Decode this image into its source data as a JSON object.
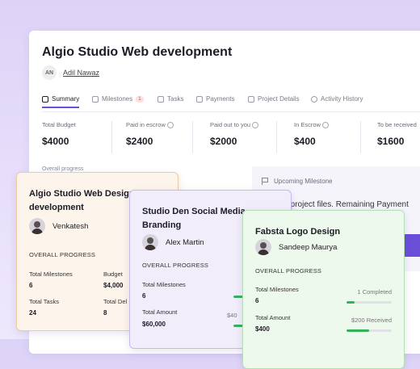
{
  "project": {
    "title": "Algio Studio Web development",
    "owner_initials": "AN",
    "owner_name": "Adil Nawaz"
  },
  "tabs": [
    {
      "label": "Summary",
      "icon": "summary-icon"
    },
    {
      "label": "Milestones",
      "icon": "flag-icon",
      "badge": "1"
    },
    {
      "label": "Tasks",
      "icon": "checkbox-icon"
    },
    {
      "label": "Payments",
      "icon": "dollar-icon"
    },
    {
      "label": "Project Details",
      "icon": "document-icon"
    },
    {
      "label": "Activity History",
      "icon": "clock-icon"
    }
  ],
  "stats": [
    {
      "label": "Total Budget",
      "value": "$4000"
    },
    {
      "label": "Paid in escrow",
      "value": "$2400"
    },
    {
      "label": "Paid out to you",
      "value": "$2000"
    },
    {
      "label": "In Escrow",
      "value": "$400"
    },
    {
      "label": "To be received",
      "value": "$1600"
    }
  ],
  "overall_progress_label": "Overall progress",
  "upcoming": {
    "label": "Upcoming Milestone",
    "text": "er project files. Remaining Payment",
    "text2": "ining"
  },
  "cards": [
    {
      "title": "Algio Studio Web Design development",
      "person": "Venkatesh",
      "overall": "OVERALL PROGRESS",
      "milestones_label": "Total Milestones",
      "milestones_value": "6",
      "budget_label": "Budget",
      "budget_value": "$4,000",
      "tasks_label": "Total Tasks",
      "tasks_value": "24",
      "deliv_label": "Total Del",
      "deliv_value": "8"
    },
    {
      "title": "Studio Den Social Media Branding",
      "person": "Alex Martin",
      "overall": "OVERALL PROGRESS",
      "milestones_label": "Total Milestones",
      "milestones_value": "6",
      "amount_label": "Total Amount",
      "amount_value": "$60,000",
      "side_amount": "$40"
    },
    {
      "title": "Fabsta Logo Design",
      "person": "Sandeep Maurya",
      "overall": "OVERALL PROGRESS",
      "milestones_label": "Total Milestones",
      "milestones_value": "6",
      "completed": "1 Completed",
      "completed_fraction": 0.17,
      "amount_label": "Total Amount",
      "amount_value": "$400",
      "received": "$200 Received",
      "received_fraction": 0.5
    }
  ],
  "colors": {
    "accent": "#6c4fd8",
    "progress": "#34b25a"
  }
}
